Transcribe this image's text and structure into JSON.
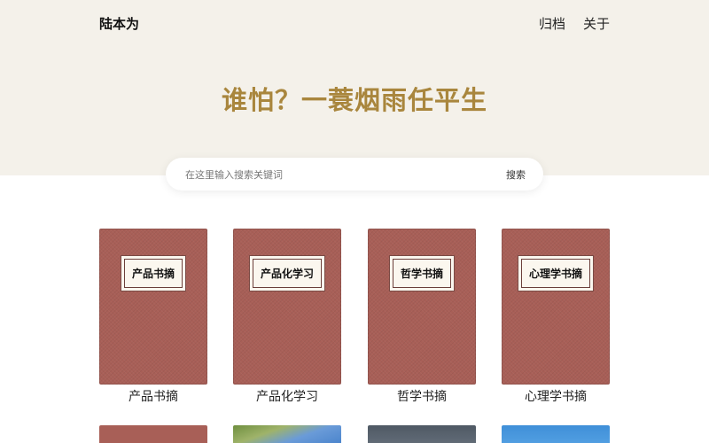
{
  "header": {
    "site_title": "陆本为",
    "nav": [
      "归档",
      "关于"
    ]
  },
  "hero": {
    "tagline": "谁怕？一蓑烟雨任平生"
  },
  "search": {
    "placeholder": "在这里输入搜索关键词",
    "button_label": "搜索"
  },
  "books": [
    {
      "cover_label": "产品书摘",
      "caption": "产品书摘"
    },
    {
      "cover_label": "产品化学习",
      "caption": "产品化学习"
    },
    {
      "cover_label": "哲学书摘",
      "caption": "哲学书摘"
    },
    {
      "cover_label": "心理学书摘",
      "caption": "心理学书摘"
    }
  ],
  "colors": {
    "hero_background": "#f4f1ea",
    "tagline": "#a9863d",
    "book_cover": "#a85f57"
  }
}
